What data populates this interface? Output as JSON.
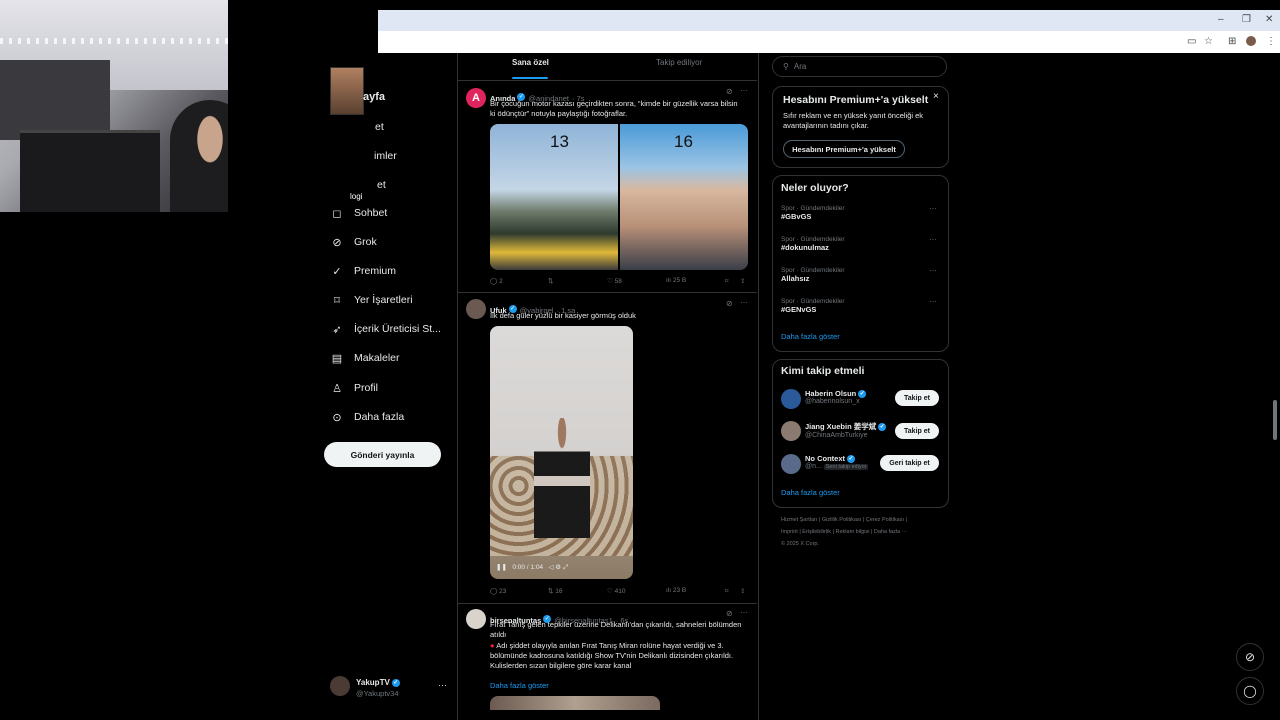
{
  "browser": {
    "window_controls": [
      "–",
      "❐",
      "✕"
    ],
    "toolbar_icons": [
      "cast-icon",
      "star-icon",
      "extension-icon",
      "profile-icon",
      "menu-icon"
    ]
  },
  "webcam": {
    "logo_text": "logi"
  },
  "nav": {
    "partial_labels": [
      "ayfa",
      "et",
      "imler",
      "et"
    ],
    "items": [
      {
        "label": "Sohbet",
        "icon": "chat-icon"
      },
      {
        "label": "Grok",
        "icon": "grok-icon"
      },
      {
        "label": "Premium",
        "icon": "premium-icon"
      },
      {
        "label": "Yer İşaretleri",
        "icon": "bookmark-icon"
      },
      {
        "label": "İçerik Üreticisi St...",
        "icon": "rocket-icon"
      },
      {
        "label": "Makaleler",
        "icon": "article-icon"
      },
      {
        "label": "Profil",
        "icon": "profile-icon"
      },
      {
        "label": "Daha fazla",
        "icon": "more-icon"
      }
    ],
    "post_button": "Gönderi yayınla"
  },
  "account": {
    "name": "YakupTV",
    "handle": "@Yakuptv34",
    "more": "···"
  },
  "tabs": {
    "for_you": "Sana özel",
    "following": "Takip ediliyor"
  },
  "posts": [
    {
      "name": "Anında",
      "handle": "@anindanet",
      "time": "· 7s",
      "text": "Bir çocuğun motor kazası geçirdikten sonra, “kimde bir güzellik varsa bilsin ki ödünçtür” notuyla paylaştığı fotoğraflar.",
      "media_labels": [
        "13",
        "16"
      ],
      "stats": {
        "replies": "2",
        "reposts": "",
        "likes": "58",
        "views": "25 B"
      }
    },
    {
      "name": "Ufuk",
      "handle": "@yabirgel",
      "time": "· 1 sa",
      "text": "İlk defa güler yüzlü bir kasiyer görmüş olduk",
      "video_controls": "0:00 / 1:04",
      "stats": {
        "replies": "23",
        "reposts": "16",
        "likes": "410",
        "views": "23 B"
      }
    },
    {
      "name": "birsenaltuntas",
      "handle": "@birsenaltuntas1",
      "time": "· 6s",
      "text1": "Fırat Tanış gelen tepkiler üzerine Delikanlı'dan çıkarıldı, sahneleri bölümden atıldı",
      "text2": "Adı şiddet olayıyla anılan Fırat Tanış Miran rolüne hayat verdiği ve 3. bölümünde kadrosuna katıldığı Show TV'nin Delikanlı dizisinden çıkarıldı. Kulislerden sızan bilgilere göre karar kanal",
      "show_more": "Daha fazla göster"
    }
  ],
  "search": {
    "placeholder": "Ara"
  },
  "premium": {
    "title": "Hesabını Premium+'a yükselt",
    "body": "Sıfır reklam ve en yüksek yanıt önceliği ek avantajlarının tadını çıkar.",
    "button": "Hesabını Premium+'a yükselt",
    "close": "×"
  },
  "trends": {
    "title": "Neler oluyor?",
    "items": [
      {
        "category": "Spor · Gündemdekiler",
        "name": "#GBvGS"
      },
      {
        "category": "Spor · Gündemdekiler",
        "name": "#dokunulmaz"
      },
      {
        "category": "Spor · Gündemdekiler",
        "name": "Allahsız"
      },
      {
        "category": "Spor · Gündemdekiler",
        "name": "#GENvGS"
      }
    ],
    "show_more": "Daha fazla göster"
  },
  "who_to_follow": {
    "title": "Kimi takip etmeli",
    "items": [
      {
        "name": "Haberin Olsun",
        "handle": "@haberinolsun_x",
        "button": "Takip et",
        "color": "#2a5a9a"
      },
      {
        "name": "Jiang Xuebin 姜学斌",
        "handle": "@ChinaAmbTurkiye",
        "button": "Takip et",
        "color": "#8a7a70"
      },
      {
        "name": "No Context",
        "handle": "@n...",
        "badge": "Seni takip ediyor",
        "button": "Geri takip et",
        "color": "#5a6a8a"
      }
    ],
    "show_more": "Daha fazla göster"
  },
  "footer": {
    "line1": "Hizmet Şartları  |  Gizlilik Politikası  |  Çerez Politikası  |",
    "line2": "Imprint  |  Erişilebilirlik  |  Reklam bilgisi  |  Daha fazla ···",
    "line3": "© 2025 X Corp."
  },
  "colors": {
    "accent": "#1d9bf0",
    "background": "#000000",
    "border": "#2f3336",
    "muted": "#71767b"
  }
}
